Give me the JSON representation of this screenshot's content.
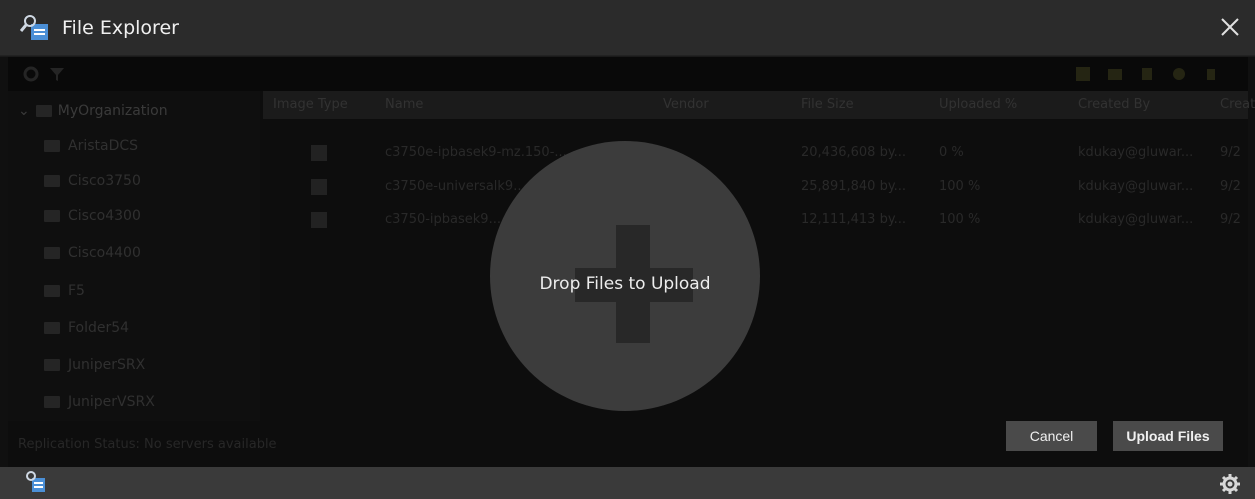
{
  "window": {
    "title": "File Explorer"
  },
  "tree": {
    "root": "MyOrganization",
    "items": [
      "AristaDCS",
      "Cisco3750",
      "Cisco4300",
      "Cisco4400",
      "F5",
      "Folder54",
      "JuniperSRX",
      "JuniperVSRX"
    ]
  },
  "grid": {
    "columns": [
      "Image Type",
      "Name",
      "Vendor",
      "File Size",
      "Uploaded %",
      "Created By",
      "Creat"
    ],
    "rows": [
      {
        "name": "c3750e-ipbasek9-mz.150-...",
        "size": "20,436,608 by...",
        "uploaded": "0 %",
        "created_by": "kdukay@gluwar...",
        "created": "9/2"
      },
      {
        "name": "c3750e-universalk9...",
        "size": "25,891,840 by...",
        "uploaded": "100 %",
        "created_by": "kdukay@gluwar...",
        "created": "9/2"
      },
      {
        "name": "c3750-ipbasek9...",
        "size": "12,111,413 by...",
        "uploaded": "100 %",
        "created_by": "kdukay@gluwar...",
        "created": "9/2"
      }
    ]
  },
  "status": "Replication Status: No servers available",
  "drop": {
    "label": "Drop Files to Upload"
  },
  "buttons": {
    "cancel": "Cancel",
    "upload": "Upload Files"
  },
  "icons": {
    "app": "file-explorer-icon",
    "close": "close-icon",
    "gear": "gear-icon",
    "filter": "filter-icon",
    "plus": "plus-icon"
  },
  "colors": {
    "background": "#1a1a1a",
    "titlebar": "#2b2b2b",
    "button": "#4a4a4a",
    "drop_circle": "#3c3c3c"
  }
}
